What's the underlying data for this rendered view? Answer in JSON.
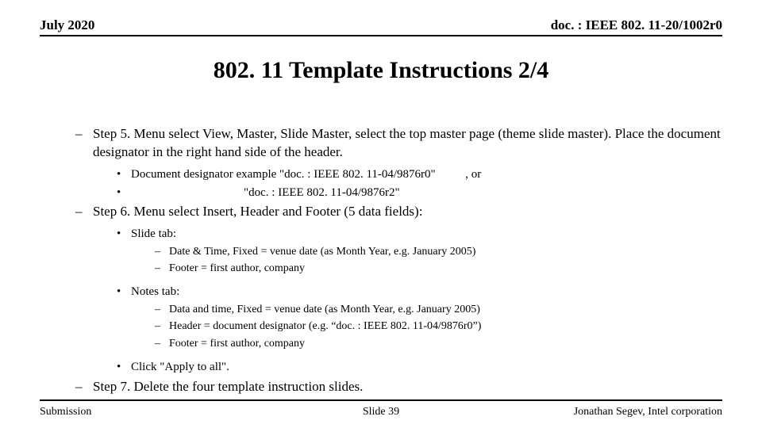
{
  "header": {
    "date": "July 2020",
    "doc": "doc. : IEEE 802. 11-20/1002r0"
  },
  "title": "802. 11 Template Instructions 2/4",
  "body": {
    "step5": "Step 5. Menu select View, Master, Slide Master, select the top master page (theme slide master).  Place the document designator in the right hand side of the header.",
    "desig1a": "Document designator example \"doc. : IEEE 802. 11-04/9876r0\"",
    "desig1b": ", or",
    "desig2": "\"doc. : IEEE 802. 11-04/9876r2\"",
    "step6": "Step 6. Menu select Insert, Header and Footer (5 data fields):",
    "slidetab": "Slide tab:",
    "slide_d1": "Date & Time, Fixed =  venue date (as Month Year, e.g. January 2005)",
    "slide_d2": "Footer = first author, company",
    "notestab": "Notes tab:",
    "notes_d1": "Data and time, Fixed = venue date (as Month Year, e.g. January 2005)",
    "notes_d2": "Header = document designator (e.g. “doc. : IEEE 802. 11-04/9876r0”)",
    "notes_d3": "Footer = first author, company",
    "apply": "Click \"Apply to all\".",
    "step7": "Step 7. Delete the four template instruction slides."
  },
  "footer": {
    "left": "Submission",
    "center": "Slide 39",
    "right": "Jonathan Segev, Intel corporation"
  }
}
